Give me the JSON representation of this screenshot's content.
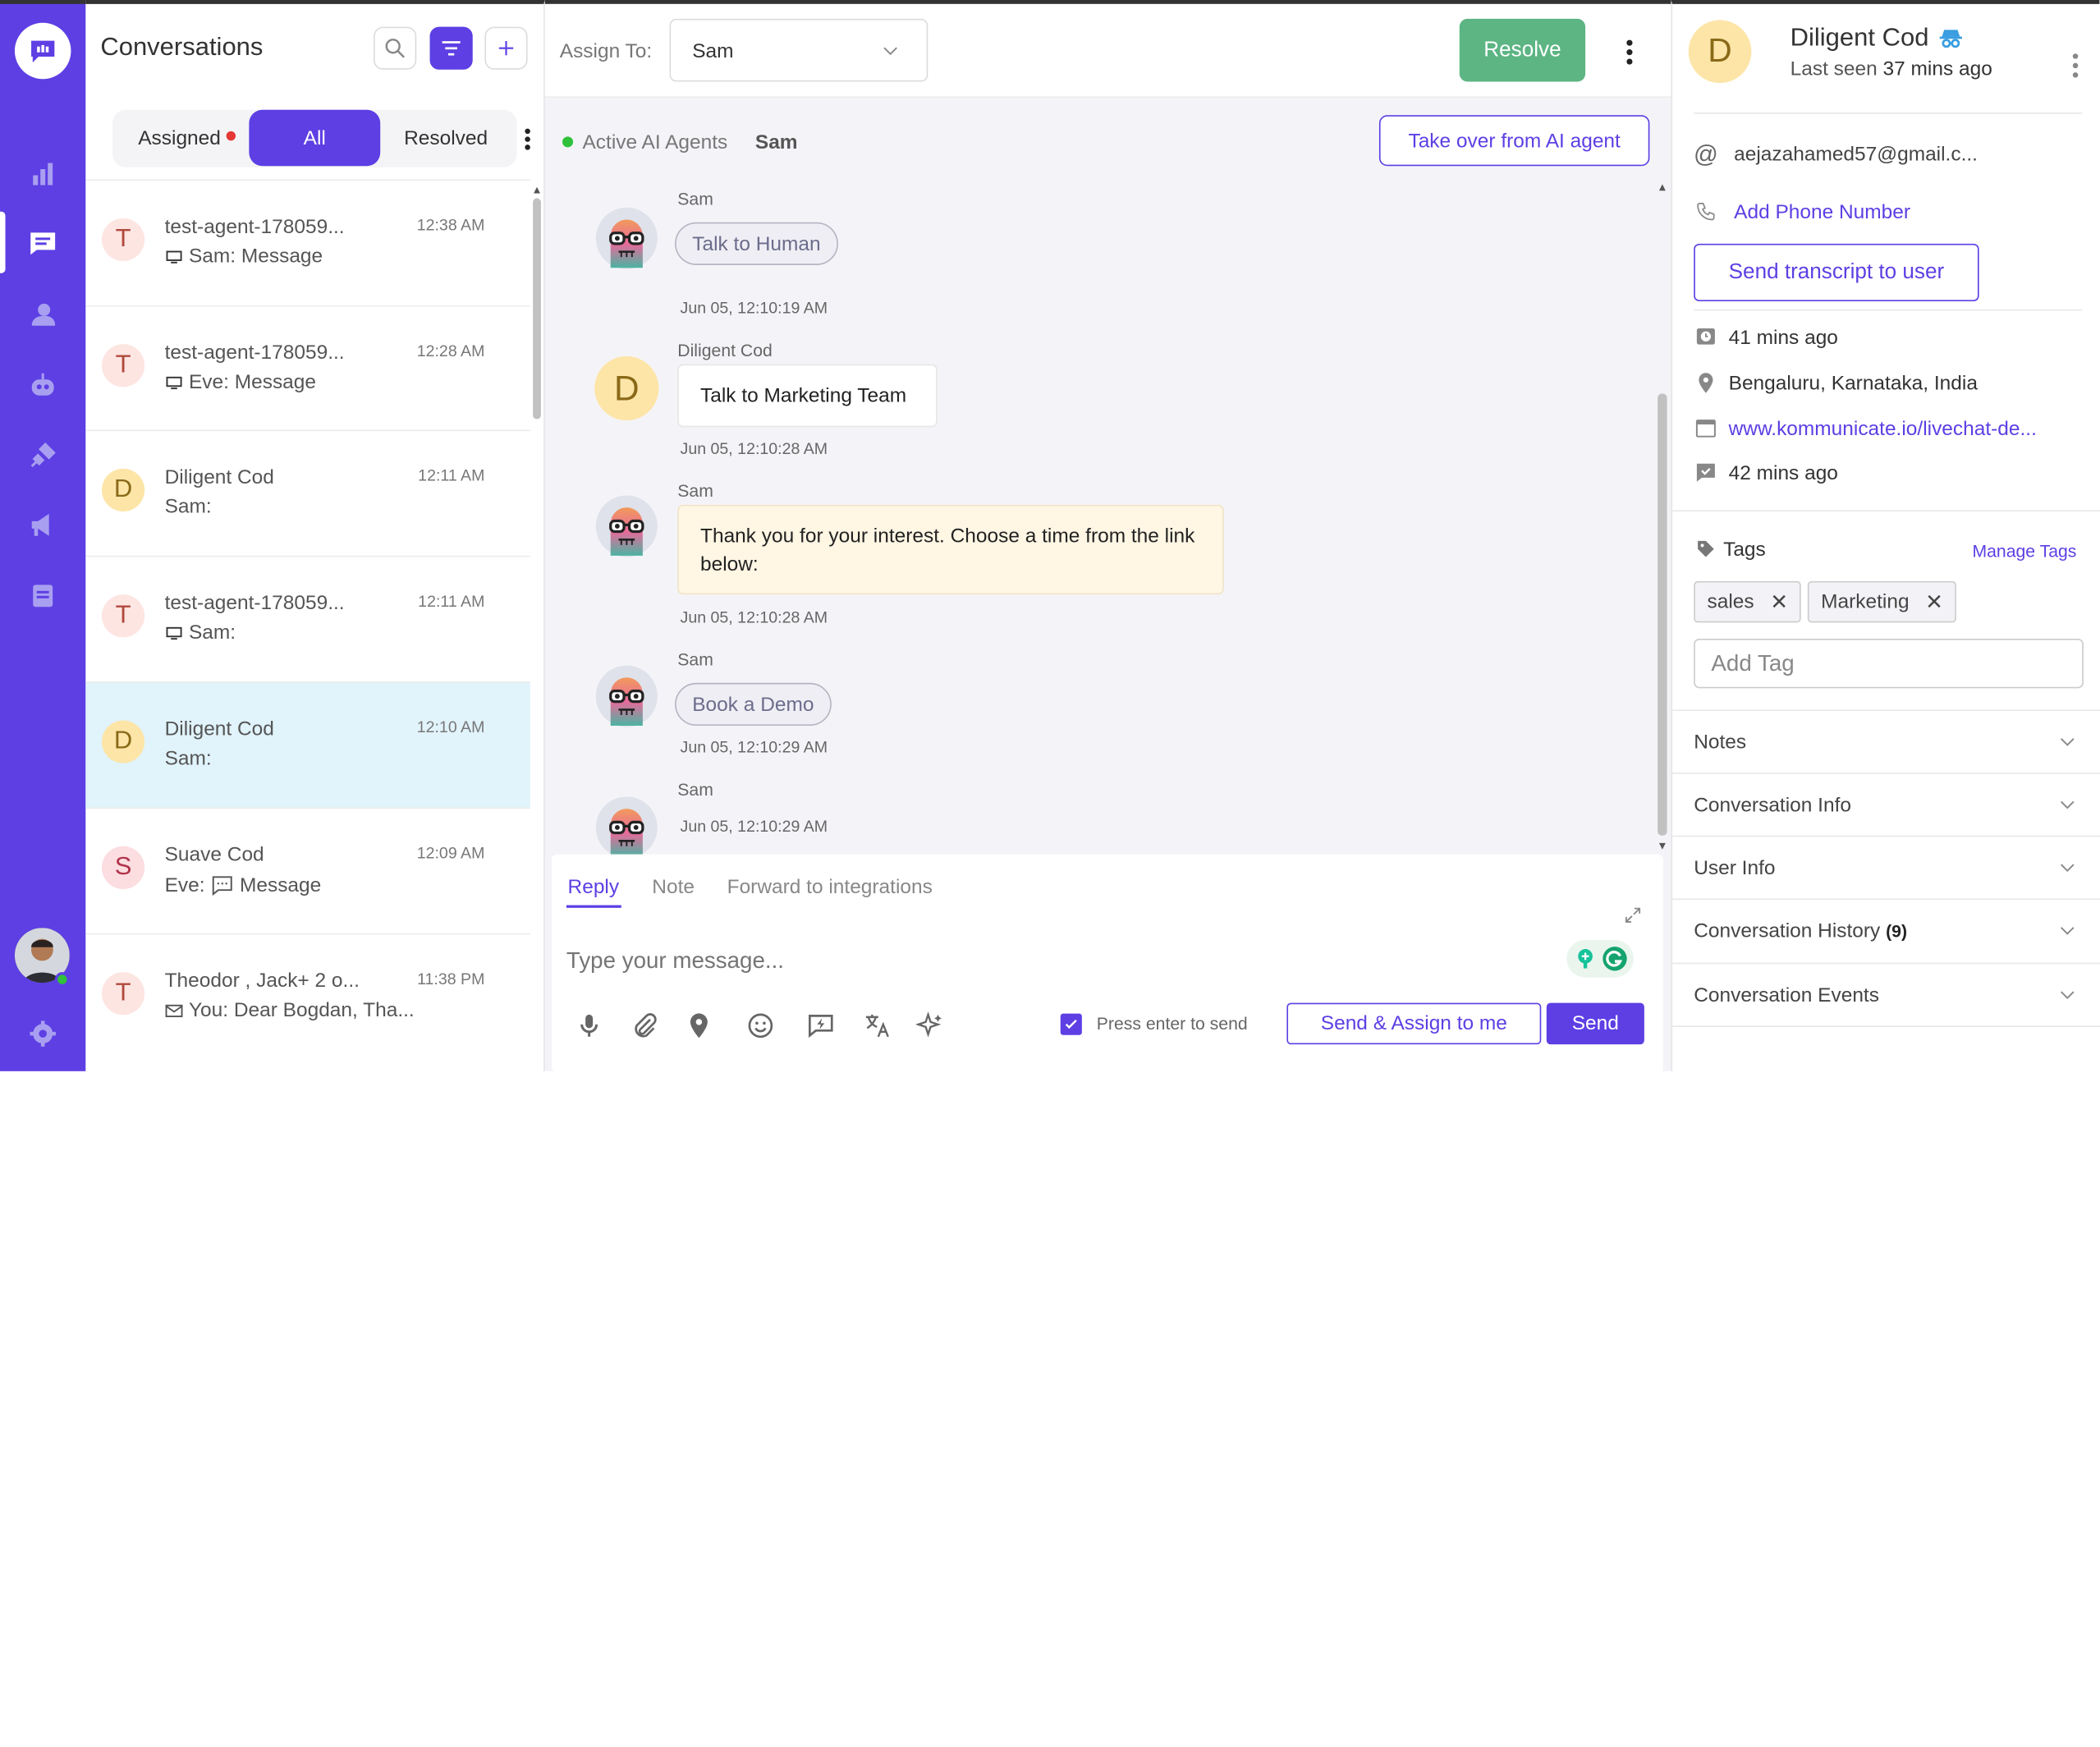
{
  "sidebar": {
    "icons": [
      "chat-logo-icon",
      "reports-icon",
      "conversations-icon",
      "contacts-icon",
      "bot-icon",
      "integrations-icon",
      "campaigns-icon",
      "knowledge-icon"
    ],
    "settings_icon": "gear-icon"
  },
  "list": {
    "title": "Conversations",
    "tabs": [
      {
        "label": "Assigned",
        "unread_dot": true
      },
      {
        "label": "All",
        "active": true
      },
      {
        "label": "Resolved"
      }
    ],
    "conversations": [
      {
        "initial": "T",
        "name": "test-agent-178059...",
        "sub": "Sam: Message",
        "time": "12:38 AM",
        "channel": "web",
        "avatar_bg": "#fde5e2",
        "avatar_fg": "#b0493c"
      },
      {
        "initial": "T",
        "name": "test-agent-178059...",
        "sub": "Eve: Message",
        "time": "12:28 AM",
        "channel": "web",
        "avatar_bg": "#fde5e2",
        "avatar_fg": "#b0493c"
      },
      {
        "initial": "D",
        "name": "Diligent Cod",
        "sub": "Sam:",
        "time": "12:11 AM",
        "channel": "",
        "avatar_bg": "#fde5a8",
        "avatar_fg": "#8a6a18"
      },
      {
        "initial": "T",
        "name": "test-agent-178059...",
        "sub": "Sam:",
        "time": "12:11 AM",
        "channel": "web",
        "avatar_bg": "#fde5e2",
        "avatar_fg": "#b0493c"
      },
      {
        "initial": "D",
        "name": "Diligent Cod",
        "sub": "Sam:",
        "time": "12:10 AM",
        "channel": "",
        "selected": true,
        "avatar_bg": "#fde5a8",
        "avatar_fg": "#8a6a18"
      },
      {
        "initial": "S",
        "name": "Suave Cod",
        "sub_prefix": "Eve:",
        "sub": "Message",
        "time": "12:09 AM",
        "channel": "message",
        "avatar_bg": "#fcdde0",
        "avatar_fg": "#b0334a"
      },
      {
        "initial": "T",
        "name": "Theodor , Jack+ 2 o...",
        "sub": "You: Dear Bogdan, Tha...",
        "time": "11:38 PM",
        "channel": "email",
        "avatar_bg": "#fde5e2",
        "avatar_fg": "#b0493c"
      }
    ]
  },
  "chat": {
    "assign_label": "Assign To:",
    "assignee": "Sam",
    "resolve_label": "Resolve",
    "ai_label": "Active AI Agents",
    "ai_agent": "Sam",
    "takeover_label": "Take over from AI agent",
    "messages": [
      {
        "sender": "Sam",
        "type": "pill",
        "text": "Talk to Human",
        "time": "Jun 05, 12:10:19 AM"
      },
      {
        "sender": "Diligent Cod",
        "type": "user",
        "text": "Talk to Marketing Team",
        "time": "Jun 05, 12:10:28 AM"
      },
      {
        "sender": "Sam",
        "type": "bot",
        "text": "Thank you for your interest. Choose a time from the link below:",
        "time": "Jun 05, 12:10:28 AM"
      },
      {
        "sender": "Sam",
        "type": "pill",
        "text": "Book a Demo",
        "time": "Jun 05, 12:10:29 AM"
      },
      {
        "sender": "Sam",
        "type": "empty",
        "text": "",
        "time": "Jun 05, 12:10:29 AM"
      }
    ],
    "composer": {
      "tabs": [
        "Reply",
        "Note",
        "Forward to integrations"
      ],
      "placeholder": "Type your message...",
      "enter_label": "Press enter to send",
      "enter_checked": true,
      "send_assign_label": "Send & Assign to me",
      "send_label": "Send"
    }
  },
  "profile": {
    "initial": "D",
    "name": "Diligent Cod",
    "last_seen_label": "Last seen",
    "last_seen": "37 mins ago",
    "email": "aejazahamed57@gmail.c...",
    "add_phone": "Add Phone Number",
    "send_transcript": "Send transcript to user",
    "first_seen": "41 mins ago",
    "location": "Bengaluru, Karnataka, India",
    "url": "www.kommunicate.io/livechat-de...",
    "last_message": "42 mins ago",
    "tags_label": "Tags",
    "manage_tags": "Manage Tags",
    "tags": [
      "sales",
      "Marketing"
    ],
    "add_tag_placeholder": "Add Tag",
    "sections": [
      {
        "label": "Notes"
      },
      {
        "label": "Conversation Info"
      },
      {
        "label": "User Info"
      },
      {
        "label": "Conversation History",
        "count": "(9)"
      },
      {
        "label": "Conversation Events"
      }
    ]
  },
  "colors": {
    "brand": "#5d3fe4",
    "resolve": "#5cb583",
    "online": "#2fc13c"
  }
}
